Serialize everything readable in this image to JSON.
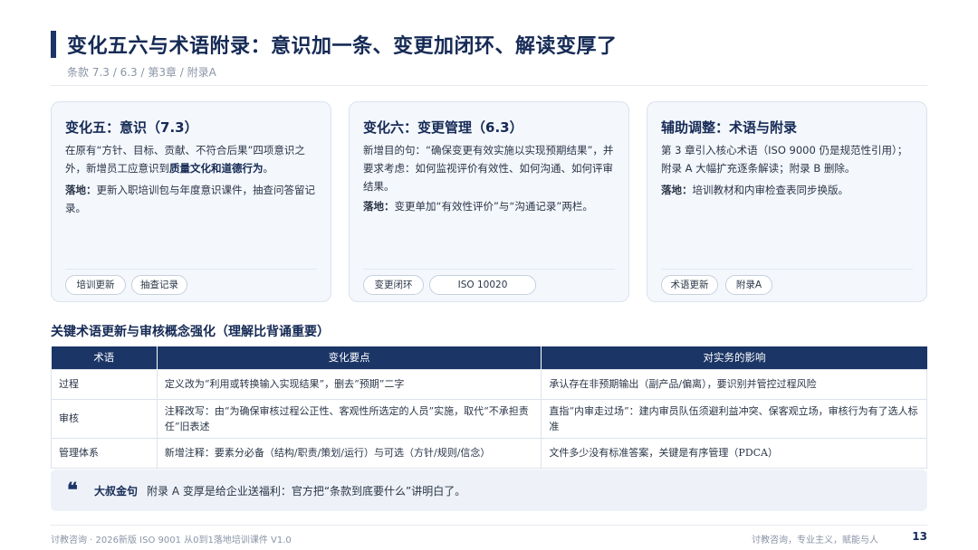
{
  "header": {
    "title": "变化五六与术语附录：意识加一条、变更加闭环、解读变厚了",
    "subtitle": "条款 7.3 / 6.3 / 第3章 / 附录A"
  },
  "cards": [
    {
      "title": "变化五：意识（7.3）",
      "body_pre": "在原有“方针、目标、贡献、不符合后果”四项意识之外，新增员工应意识到",
      "body_bold": "质量文化和道德行为",
      "body_post": "。",
      "land_label": "落地：",
      "land_text": "更新入职培训包与年度意识课件，抽查问答留记录。",
      "tags": [
        "培训更新",
        "抽查记录"
      ]
    },
    {
      "title": "变化六：变更管理（6.3）",
      "body_pre": "新增目的句：“确保变更有效实施以实现预期结果”，并要求考虑：如何监视评价有效性、如何沟通、如何评审结果。",
      "body_bold": "",
      "body_post": "",
      "land_label": "落地：",
      "land_text": "变更单加“有效性评价”与“沟通记录”两栏。",
      "tags": [
        "变更闭环",
        "ISO 10020"
      ]
    },
    {
      "title": "辅助调整：术语与附录",
      "body_pre": "第 3 章引入核心术语（ISO 9000 仍是规范性引用）；附录 A 大幅扩充逐条解读；附录 B 删除。",
      "body_bold": "",
      "body_post": "",
      "land_label": "落地：",
      "land_text": "培训教材和内审检查表同步换版。",
      "tags": [
        "术语更新",
        "附录A"
      ]
    }
  ],
  "section": {
    "title": "关键术语更新与审核概念强化（理解比背诵重要）"
  },
  "table": {
    "headers": [
      "术语",
      "变化要点",
      "对实务的影响"
    ],
    "rows": [
      [
        "过程",
        "定义改为“利用或转换输入实现结果”，删去“预期”二字",
        "承认存在非预期输出（副产品/偏离），要识别并管控过程风险"
      ],
      [
        "审核",
        "注释改写：由“为确保审核过程公正性、客观性所选定的人员”实施，取代“不承担责任”旧表述",
        "直指“内审走过场”：建内审员队伍须避利益冲突、保客观立场，审核行为有了选人标准"
      ],
      [
        "管理体系",
        "新增注释：要素分必备（结构/职责/策划/运行）与可选（方针/规则/信念）",
        "文件多少没有标准答案，关键是有序管理（PDCA）"
      ]
    ]
  },
  "quote": {
    "mark": "❝",
    "label": "大叔金句",
    "text": "附录 A 变厚是给企业送福利：官方把“条款到底要什么”讲明白了。"
  },
  "footer": {
    "left": "讨教咨询 · 2026新版 ISO 9001 从0到1落地培训课件 V1.0",
    "right": "讨教咨询，专业主义，赋能与人",
    "page": "13"
  },
  "colors": {
    "brand_navy": "#1b3566",
    "card_bg": "#f4f7fc"
  }
}
